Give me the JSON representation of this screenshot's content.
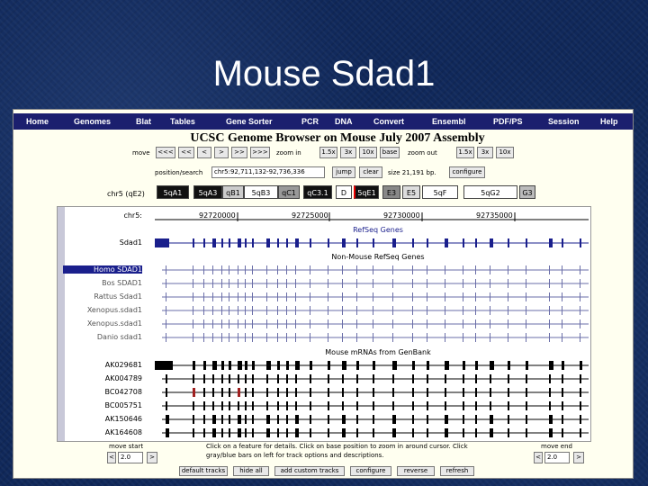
{
  "slide": {
    "title": "Mouse Sdad1"
  },
  "nav": [
    "Home",
    "Genomes",
    "Blat",
    "Tables",
    "Gene Sorter",
    "PCR",
    "DNA",
    "Convert",
    "Ensembl",
    "PDF/PS",
    "Session",
    "Help"
  ],
  "header": {
    "title": "UCSC Genome Browser on Mouse July 2007 Assembly"
  },
  "move": {
    "label": "move",
    "buttons": [
      "<<<",
      "<<",
      "<",
      ">",
      ">>",
      ">>>"
    ],
    "zoom_in_label": "zoom in",
    "zoom_in": [
      "1.5x",
      "3x",
      "10x",
      "base"
    ],
    "zoom_out_label": "zoom out",
    "zoom_out": [
      "1.5x",
      "3x",
      "10x"
    ]
  },
  "position": {
    "label": "position/search",
    "value": "chr5:92,711,132-92,736,336",
    "jump": "jump",
    "clear": "clear",
    "size": "size 21,191 bp.",
    "configure": "configure"
  },
  "ideogram": {
    "chrom_label": "chr5 (qE2)",
    "bands": [
      {
        "name": "5qA1",
        "color": "#111111",
        "text_color": "#ffffff"
      },
      {
        "name": "5qA3",
        "color": "#111111",
        "text_color": "#ffffff"
      },
      {
        "name": "qB1",
        "color": "#cccccc",
        "text_color": "#000000"
      },
      {
        "name": "5qB3",
        "color": "#ffffff",
        "text_color": "#000000"
      },
      {
        "name": "qC1",
        "color": "#999999",
        "text_color": "#000000"
      },
      {
        "name": "qC3.1",
        "color": "#111111",
        "text_color": "#ffffff"
      },
      {
        "name": "D",
        "color": "#ffffff",
        "text_color": "#000000"
      },
      {
        "name": "5qE1",
        "color": "#111111",
        "text_color": "#ffffff"
      },
      {
        "name": "E3",
        "color": "#888888",
        "text_color": "#000000"
      },
      {
        "name": "E5",
        "color": "#dddddd",
        "text_color": "#000000"
      },
      {
        "name": "5qF",
        "color": "#ffffff",
        "text_color": "#000000"
      },
      {
        "name": "5qG2",
        "color": "#ffffff",
        "text_color": "#000000"
      },
      {
        "name": "G3",
        "color": "#bbbbbb",
        "text_color": "#000000"
      }
    ]
  },
  "ruler": {
    "chrom": "chr5:",
    "ticks": [
      "92720000",
      "92725000",
      "92730000",
      "92735000"
    ]
  },
  "tracks": {
    "refseq_title": "RefSeq Genes",
    "refseq_label": "Sdad1",
    "nonmouse_title": "Non-Mouse RefSeq Genes",
    "nonmouse_labels": [
      "Homo SDAD1",
      "Bos SDAD1",
      "Rattus Sdad1",
      "Xenopus.sdad1",
      "Xenopus.sdad1",
      "Danio sdad1"
    ],
    "mrna_title": "Mouse mRNAs from GenBank",
    "mrna_labels": [
      "AK029681",
      "AK004789",
      "BC042708",
      "BC005751",
      "AK150646",
      "AK164608"
    ]
  },
  "bottom": {
    "move_start_label": "move start",
    "move_start_value": "2.0",
    "move_end_label": "move end",
    "move_end_value": "2.0",
    "help_line1": "Click on a feature for details. Click on base position to zoom in around cursor. Click",
    "help_line2": "gray/blue bars on left for track options and descriptions.",
    "footer_buttons": [
      "default tracks",
      "hide all",
      "add custom tracks",
      "configure",
      "reverse",
      "refresh"
    ]
  },
  "colors": {
    "nav_bg": "#1b1f6e",
    "gene_blue": "#1a1f8c",
    "panel_bg": "#fffff0",
    "slide_bg": "#10285a"
  }
}
